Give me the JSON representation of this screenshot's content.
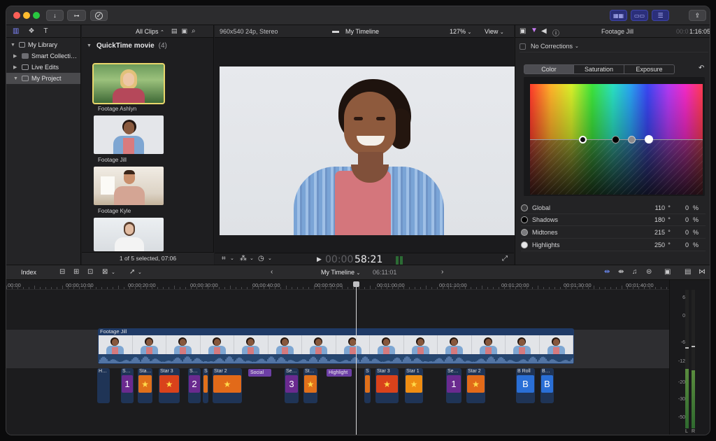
{
  "toolbar": {
    "import_icon": "arrow-down-icon",
    "keywords_icon": "key-icon",
    "check_icon": "checkmark-icon",
    "share_icon": "share-icon"
  },
  "sidebar": {
    "items": [
      {
        "label": "My Library",
        "expanded": true,
        "level": 0
      },
      {
        "label": "Smart Collecti…",
        "expanded": false,
        "level": 1
      },
      {
        "label": "Live Edits",
        "expanded": false,
        "level": 1
      },
      {
        "label": "My Project",
        "expanded": true,
        "level": 1,
        "selected": true
      }
    ]
  },
  "browser": {
    "filter": "All Clips",
    "filter_suffix": "⌃",
    "section_title": "QuickTime movie",
    "section_count": "(4)",
    "clips": [
      {
        "name": "Footage Ashlyn",
        "selected": true
      },
      {
        "name": "Footage Jill",
        "selected": false
      },
      {
        "name": "Footage Kyle",
        "selected": false
      },
      {
        "name": "",
        "selected": false
      }
    ],
    "status": "1 of 5 selected, 07:06"
  },
  "viewer": {
    "format": "960x540 24p, Stereo",
    "project_title": "My Timeline",
    "zoom": "127%",
    "view_label": "View",
    "timecode_dim": "00:00",
    "timecode": "58:21"
  },
  "inspector": {
    "clip_name": "Footage Jill",
    "duration_dim": "00:0",
    "duration": "1:16:05",
    "corrections": "No Corrections",
    "tabs": [
      "Color",
      "Saturation",
      "Exposure"
    ],
    "active_tab": "Color",
    "controls": [
      {
        "label": "Global",
        "angle": "110",
        "deg": "°",
        "pct": "0",
        "unit": "%"
      },
      {
        "label": "Shadows",
        "angle": "180",
        "deg": "°",
        "pct": "0",
        "unit": "%"
      },
      {
        "label": "Midtones",
        "angle": "215",
        "deg": "°",
        "pct": "0",
        "unit": "%"
      },
      {
        "label": "Highlights",
        "angle": "250",
        "deg": "°",
        "pct": "0",
        "unit": "%"
      }
    ]
  },
  "timeline": {
    "index_label": "Index",
    "title": "My Timeline",
    "duration": "06:11:01",
    "ruler": [
      "00:00",
      "00:00:10:00",
      "00:00:20:00",
      "00:00:30:00",
      "00:00:40:00",
      "00:00:50:00",
      "00:01:00:00",
      "00:01:10:00",
      "00:01:20:00",
      "00:01:30:00",
      "00:01:40:00"
    ],
    "primary_clip": "Footage Jill",
    "connected": [
      {
        "label": "H…",
        "glyph": "",
        "color": "#1f3456"
      },
      {
        "label": "S…",
        "glyph": "1",
        "color": "#6a2a8f"
      },
      {
        "label": "Sta…",
        "glyph": "★",
        "color": "#e0701a"
      },
      {
        "label": "Star 3",
        "glyph": "★",
        "color": "#d9421b"
      },
      {
        "label": "S…",
        "glyph": "2",
        "color": "#6a2a8f"
      },
      {
        "label": "S",
        "glyph": "",
        "color": "#e0701a"
      },
      {
        "label": "Star 2",
        "glyph": "★",
        "color": "#e26a19"
      },
      {
        "label": "Se…",
        "glyph": "3",
        "color": "#6a2a8f"
      },
      {
        "label": "St…",
        "glyph": "★",
        "color": "#e0701a"
      },
      {
        "label": "S",
        "glyph": "",
        "color": "#e0701a"
      },
      {
        "label": "Star 3",
        "glyph": "★",
        "color": "#d9421b"
      },
      {
        "label": "Star 1",
        "glyph": "★",
        "color": "#ef8d12"
      },
      {
        "label": "Se…",
        "glyph": "1",
        "color": "#6a2a8f"
      },
      {
        "label": "Star 2",
        "glyph": "★",
        "color": "#e26a19"
      },
      {
        "label": "B Roll",
        "glyph": "B",
        "color": "#2a6fd6"
      },
      {
        "label": "B…",
        "glyph": "B",
        "color": "#2a6fd6"
      }
    ],
    "titles": [
      {
        "label": "Social"
      },
      {
        "label": "Highlight"
      }
    ]
  },
  "meter": {
    "scale": [
      "6",
      "0",
      "-6",
      "-12",
      "-20",
      "-30",
      "-50"
    ],
    "left": "L",
    "right": "R"
  }
}
